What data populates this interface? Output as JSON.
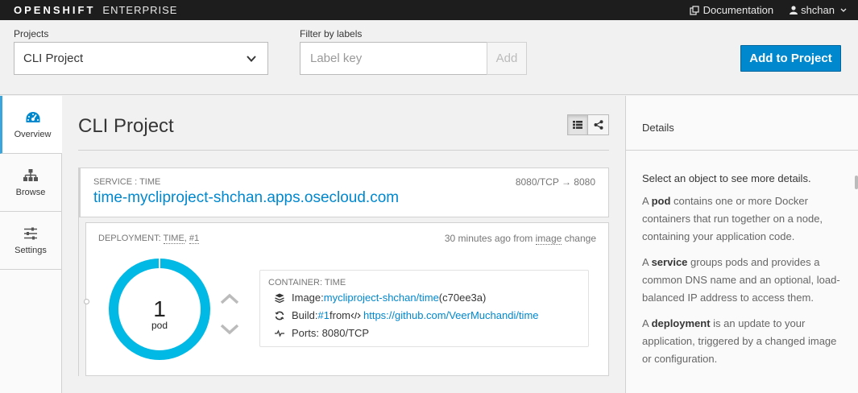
{
  "header": {
    "brand_bold": "OPENSHIFT",
    "brand_light": "ENTERPRISE",
    "documentation_label": "Documentation",
    "user_label": "shchan"
  },
  "filters": {
    "projects_label": "Projects",
    "project_value": "CLI Project",
    "filter_label": "Filter by labels",
    "label_key_placeholder": "Label key",
    "add_label": "Add",
    "add_to_project_label": "Add to Project"
  },
  "sidebar": {
    "items": [
      {
        "label": "Overview",
        "icon": "dashboard-icon",
        "active": true
      },
      {
        "label": "Browse",
        "icon": "sitemap-icon",
        "active": false
      },
      {
        "label": "Settings",
        "icon": "sliders-icon",
        "active": false
      }
    ]
  },
  "main": {
    "title": "CLI Project",
    "service": {
      "label": "SERVICE : TIME",
      "ports": "8080/TCP → 8080",
      "route": "time-mycliproject-shchan.apps.osecloud.com"
    },
    "deployment": {
      "label_prefix": "DEPLOYMENT: ",
      "name": "TIME",
      "separator": ", ",
      "version": "#1",
      "time_prefix": "30 minutes ago from ",
      "trigger": "image",
      "time_suffix": " change",
      "pod_count": "1",
      "pod_unit": "pod",
      "container": {
        "label": "CONTAINER: TIME",
        "image_label": "Image: ",
        "image_link": "mycliproject-shchan/time",
        "image_hash": " (c70ee3a)",
        "build_label": "Build: ",
        "build_link": "#1",
        "build_from": " from ",
        "build_repo": "https://github.com/VeerMuchandi/time",
        "ports": "Ports: 8080/TCP"
      }
    }
  },
  "details": {
    "title": "Details",
    "lead": "Select an object to see more details.",
    "pod_term": "pod",
    "pod_text_pre": "A ",
    "pod_text": " contains one or more Docker containers that run together on a node, containing your application code.",
    "service_term": "service",
    "service_text": " groups pods and provides a common DNS name and an optional, load-balanced IP address to access them.",
    "deployment_term": "deployment",
    "deployment_text": " is an update to your application, triggered by a changed image or configuration."
  },
  "colors": {
    "accent": "#0088ce",
    "donut": "#00b9e4",
    "topbar": "#1d1d1d"
  }
}
